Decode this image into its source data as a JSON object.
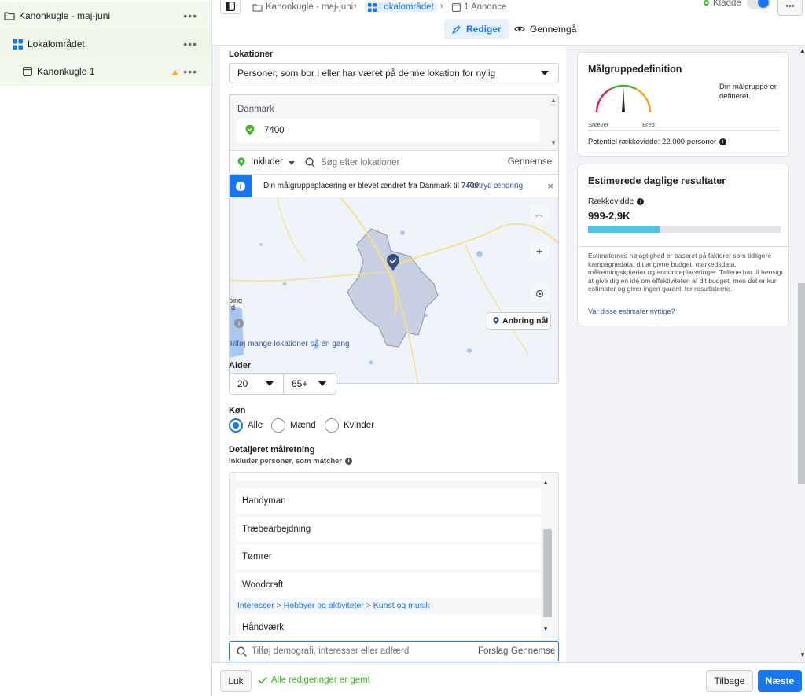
{
  "sidebar": {
    "items": [
      {
        "label": "Kanonkugle - maj-juni",
        "icon": "folder-icon"
      },
      {
        "label": "Lokalområdet",
        "icon": "grid-icon"
      },
      {
        "label": "Kanonkugle 1",
        "icon": "ad-icon"
      }
    ]
  },
  "topbar": {
    "breadcrumb": [
      "Kanonkugle - maj-juni",
      "Lokalområdet",
      "1 Annonce"
    ],
    "draft_label": "Kladde",
    "edit_tab": "Rediger",
    "review_tab": "Gennemgå"
  },
  "locations": {
    "section_label": "Lokationer",
    "type_select": "Personer, som bor i eller har været på denne lokation for nylig",
    "country": "Danmark",
    "postal_code": "7400",
    "include_label": "Inkluder",
    "search_placeholder": "Søg efter lokationer",
    "browse_label": "Gennemse",
    "notice_text": "Din målgruppeplacering er blevet ændret fra Danmark til 7400.",
    "notice_undo": "Fortryd ændring",
    "pin_button": "Anbring nål",
    "map_text_left": "bing rd",
    "add_many_link": "Tilføj mange lokationer på én gang"
  },
  "age": {
    "label": "Alder",
    "min": "20",
    "max": "65+"
  },
  "gender": {
    "label": "Køn",
    "options": [
      "Alle",
      "Mænd",
      "Kvinder"
    ],
    "selected": 0
  },
  "detailed": {
    "label": "Detaljeret målretning",
    "sublabel": "Inkluder personer, som matcher",
    "items": [
      "Handyman",
      "Træbearbejdning",
      "Tømrer",
      "Woodcraft"
    ],
    "category_path": [
      "Interesser",
      "Hobbyer og aktiviteter",
      "Kunst og musik"
    ],
    "last_item": "Håndværk",
    "search_placeholder": "Tilføj demografi, interesser eller adfærd",
    "suggest_label": "Forslag",
    "browse_label": "Gennemse"
  },
  "audience_card": {
    "title": "Målgruppedefinition",
    "status": "Din målgruppe er defineret.",
    "narrow_label": "Snæver",
    "broad_label": "Bred",
    "potential_reach": "Potentiel rækkevidde: 22.000 personer"
  },
  "estimates_card": {
    "title": "Estimerede daglige resultater",
    "reach_label": "Rækkevidde",
    "reach_value": "999-2,9K",
    "reach_fill": 0.37,
    "disclaimer": "Estimaternes nøjagtighed er baseret på faktorer som tidligere kampagnedata, dit angivne budget, markedsdata, målretningskriterier og annonceplaceringer. Tallene har til hensigt at give dig en idé om effektiviteten af dit budget, men det er kun estimater og giver ingen garanti for resultaterne.",
    "helpful_link": "Var disse estimater nyttige?"
  },
  "bottombar": {
    "close_button": "Luk",
    "saved_status": "Alle redigeringer er gemt",
    "back_button": "Tilbage",
    "next_button": "Næste"
  },
  "colors": {
    "accent": "#1877f2",
    "reach_bar": "#4fc3e8",
    "success": "#42b72a",
    "warning": "#f5a623"
  }
}
